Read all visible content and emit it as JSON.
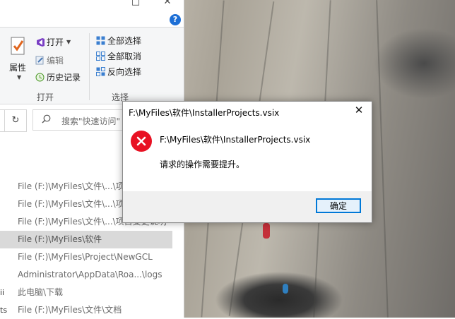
{
  "explorer": {
    "help_glyph": "?",
    "ribbon": {
      "properties_label": "属性",
      "open_label": "打开",
      "edit_label": "编辑",
      "history_label": "历史记录",
      "open_group": "打开",
      "select_all": "全部选择",
      "select_none": "全部取消",
      "invert_selection": "反向选择",
      "select_group": "选择"
    },
    "refresh_glyph": "↻",
    "search_placeholder": "搜索\"快速访问\"",
    "recent_items": [
      {
        "path": "File (F:)\\MyFiles\\文件\\...\\项目",
        "marker": ""
      },
      {
        "path": "File (F:)\\MyFiles\\文件\\...\\项目",
        "marker": ""
      },
      {
        "path": "File (F:)\\MyFiles\\文件\\...\\项目变更说明",
        "marker": ""
      },
      {
        "path": "File (F:)\\MyFiles\\软件",
        "marker": ""
      },
      {
        "path": "File (F:)\\MyFiles\\Project\\NewGCL",
        "marker": ""
      },
      {
        "path": "Administrator\\AppData\\Roa...\\logs",
        "marker": ""
      },
      {
        "path": "此电脑\\下载",
        "marker": "ii"
      },
      {
        "path": "File (F:)\\MyFiles\\文件\\文档",
        "marker": "ts"
      }
    ]
  },
  "dialog": {
    "title": "F:\\MyFiles\\软件\\InstallerProjects.vsix",
    "path": "F:\\MyFiles\\软件\\InstallerProjects.vsix",
    "message": "请求的操作需要提升。",
    "ok_label": "确定",
    "close_glyph": "✕",
    "error_color": "#e81123"
  }
}
